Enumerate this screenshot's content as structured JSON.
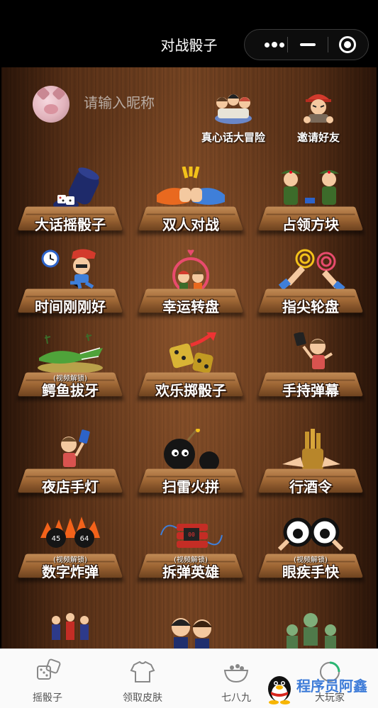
{
  "nav": {
    "title": "对战骰子",
    "more_icon": "more-dots-icon",
    "minimize_icon": "minimize-icon",
    "close_icon": "target-close-icon"
  },
  "profile": {
    "nickname_placeholder": "请输入昵称",
    "avatar_icon": "pig-avatar"
  },
  "top_links": [
    {
      "label": "真心话大冒险",
      "icon": "truth-or-dare-icon"
    },
    {
      "label": "邀请好友",
      "icon": "invite-friend-icon"
    }
  ],
  "games": [
    {
      "name": "大话摇骰子",
      "icon": "dice-cup-icon"
    },
    {
      "name": "双人对战",
      "icon": "fist-bump-icon"
    },
    {
      "name": "占领方块",
      "icon": "soldiers-icon"
    },
    {
      "name": "时间刚刚好",
      "icon": "alarm-clock-icon"
    },
    {
      "name": "幸运转盘",
      "icon": "lucky-wheel-icon"
    },
    {
      "name": "指尖轮盘",
      "icon": "finger-touch-icon"
    },
    {
      "name": "鳄鱼拔牙",
      "icon": "crocodile-icon",
      "lock_text": "(视频解锁)"
    },
    {
      "name": "欢乐掷骰子",
      "icon": "gold-dice-icon"
    },
    {
      "name": "手持弹幕",
      "icon": "handheld-barrage-icon"
    },
    {
      "name": "夜店手灯",
      "icon": "phone-light-icon"
    },
    {
      "name": "扫雷火拼",
      "icon": "bomb-icon"
    },
    {
      "name": "行酒令",
      "icon": "bamboo-sticks-icon"
    },
    {
      "name": "数字炸弹",
      "icon": "number-bomb-icon",
      "lock_text": "(视频解锁)"
    },
    {
      "name": "拆弹英雄",
      "icon": "dynamite-icon",
      "lock_text": "(视频解锁)"
    },
    {
      "name": "眼疾手快",
      "icon": "big-eyes-icon",
      "lock_text": "(视频解锁)"
    }
  ],
  "tabbar": {
    "items": [
      {
        "label": "摇骰子",
        "icon": "dice-tab-icon"
      },
      {
        "label": "领取皮肤",
        "icon": "shirt-tab-icon"
      },
      {
        "label": "七八九",
        "icon": "bowl-tab-icon"
      },
      {
        "label": "大玩家",
        "icon": "player-tab-icon"
      }
    ]
  },
  "watermark": {
    "text": "程序员阿鑫",
    "icon": "qq-penguin-icon"
  },
  "colors": {
    "tab_text": "#555555",
    "wood_dark": "#2b1509",
    "wood_light": "#7a4724"
  }
}
